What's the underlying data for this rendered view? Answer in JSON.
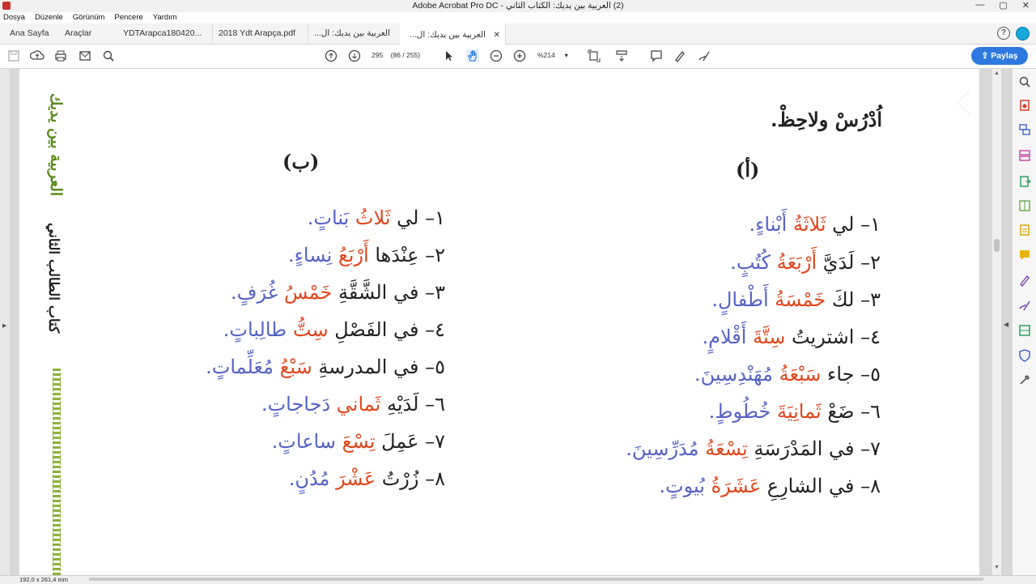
{
  "window": {
    "title": "(2) العربية بين يديك: الكتاب الثاني - Adobe Acrobat Pro DC",
    "controls": [
      "—",
      "▢",
      "✕"
    ]
  },
  "menu": [
    "Dosya",
    "Düzenle",
    "Görünüm",
    "Pencere",
    "Yardım"
  ],
  "tabs": {
    "home": "Ana Sayfa",
    "tools": "Araçlar",
    "docs": [
      {
        "label": "YDTArapca180420..."
      },
      {
        "label": "2018 Ydt Arapça.pdf"
      },
      {
        "label": "العربية بين يديك: ال..."
      },
      {
        "label": "العربية بين يديك: ال..."
      }
    ],
    "close_glyph": "✕"
  },
  "toolbar": {
    "page_current": "295",
    "page_info": "(86 / 255)",
    "zoom": "%214",
    "share_label": "Paylaş",
    "help_glyph": "?"
  },
  "status": {
    "page_size": "192,0 x 261,4 mm"
  },
  "document": {
    "side_title": "العربية بين يديك",
    "side_subtitle": "كتاب الطالب الثاني",
    "heading": "اُدْرُسْ ولاحِظْ.",
    "col_a_label": "(أ)",
    "col_b_label": "(ب)",
    "col_a": [
      {
        "num": "١–",
        "w": "لي",
        "n": "ثَلاثَةُ",
        "p": "أَبْناءٍ."
      },
      {
        "num": "٢–",
        "w": "لَدَيَّ",
        "n": "أَرْبَعَةُ",
        "p": "كُتُبٍ."
      },
      {
        "num": "٣–",
        "w": "لكَ",
        "n": "خَمْسَةُ",
        "p": "أَطْفالٍ."
      },
      {
        "num": "٤–",
        "w": "اشتريتُ",
        "n": "سِتَّةَ",
        "p": "أَقْلامٍ."
      },
      {
        "num": "٥–",
        "w": "جاء",
        "n": "سَبْعَةُ",
        "p": "مُهَنْدِسِينَ."
      },
      {
        "num": "٦–",
        "w": "ضَعْ",
        "n": "ثَمانِيَةَ",
        "p": "خُطُوطٍ."
      },
      {
        "num": "٧–",
        "w": "في المَدْرَسَةِ",
        "n": "تِسْعَةُ",
        "p": "مُدَرِّسِينَ."
      },
      {
        "num": "٨–",
        "w": "في الشارِعِ",
        "n": "عَشَرَةُ",
        "p": "بُيوتٍ."
      }
    ],
    "col_b": [
      {
        "num": "١–",
        "w": "لي",
        "n": "ثَلاثُ",
        "p": "بَناتٍ."
      },
      {
        "num": "٢–",
        "w": "عِنْدَها",
        "n": "أَرْبَعُ",
        "p": "نِساءٍ."
      },
      {
        "num": "٣–",
        "w": "في الشَّقَّةِ",
        "n": "خَمْسُ",
        "p": "غُرَفٍ."
      },
      {
        "num": "٤–",
        "w": "في الفَصْلِ",
        "n": "سِتُّ",
        "p": "طالِباتٍ."
      },
      {
        "num": "٥–",
        "w": "في المدرسةِ",
        "n": "سَبْعُ",
        "p": "مُعَلِّماتٍ."
      },
      {
        "num": "٦–",
        "w": "لَدَيْهِ",
        "n": "ثَماني",
        "p": "دَجاجاتٍ."
      },
      {
        "num": "٧–",
        "w": "عَمِلَ",
        "n": "تِسْعَ",
        "p": "ساعاتٍ."
      },
      {
        "num": "٨–",
        "w": "زُرْتُ",
        "n": "عَشْرَ",
        "p": "مُدُنٍ."
      }
    ]
  },
  "colors": {
    "number_word": "#e2451c",
    "plural_noun": "#5562c4",
    "share_button": "#2d79e0"
  }
}
